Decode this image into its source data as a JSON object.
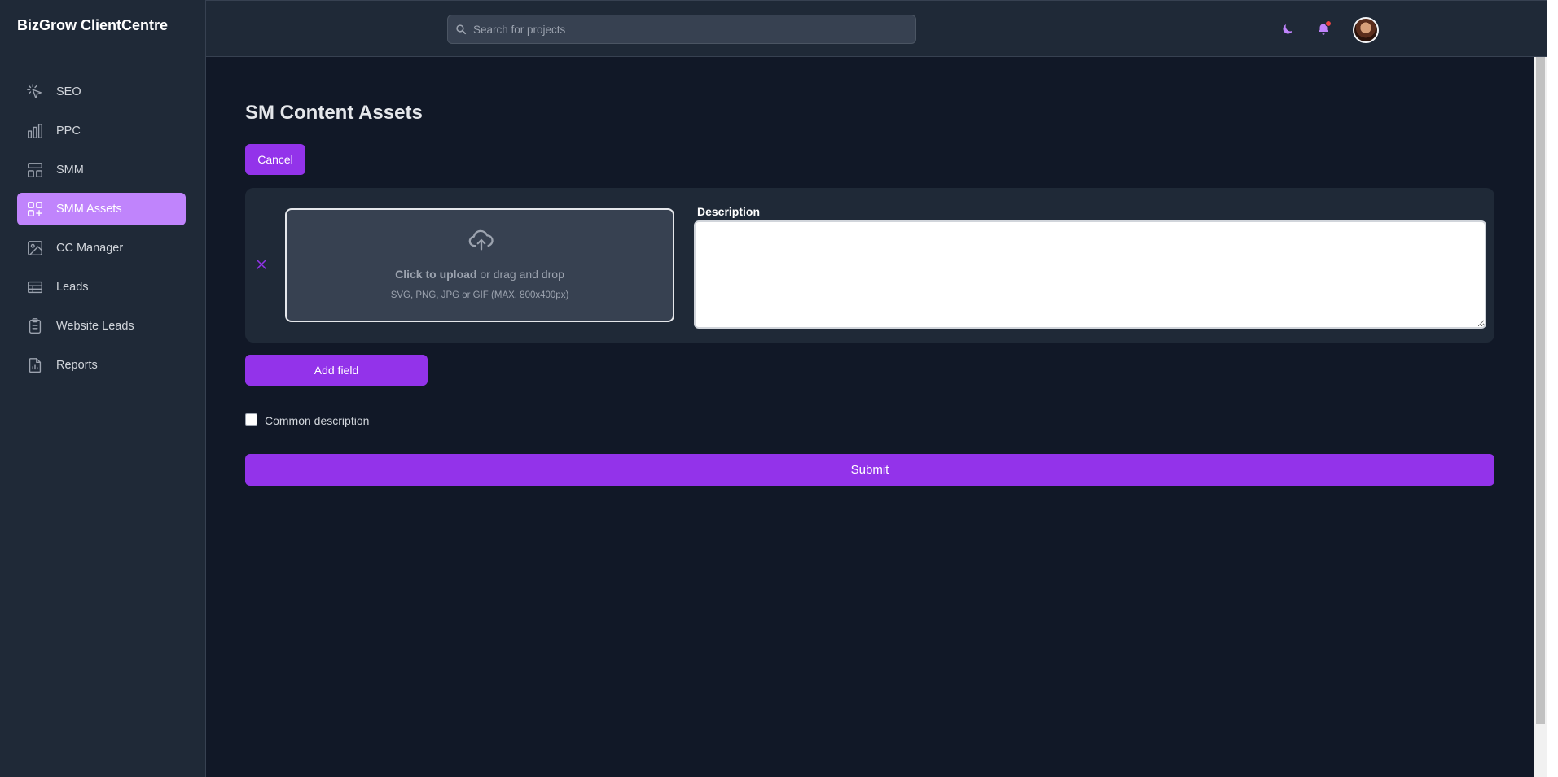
{
  "app": {
    "brand": "BizGrow ClientCentre"
  },
  "sidebar": {
    "items": [
      {
        "label": "SEO",
        "icon": "cursor-click-icon",
        "active": false
      },
      {
        "label": "PPC",
        "icon": "bar-chart-icon",
        "active": false
      },
      {
        "label": "SMM",
        "icon": "layout-icon",
        "active": false
      },
      {
        "label": "SMM Assets",
        "icon": "grid-plus-icon",
        "active": true
      },
      {
        "label": "CC Manager",
        "icon": "image-icon",
        "active": false
      },
      {
        "label": "Leads",
        "icon": "table-icon",
        "active": false
      },
      {
        "label": "Website Leads",
        "icon": "clipboard-icon",
        "active": false
      },
      {
        "label": "Reports",
        "icon": "document-chart-icon",
        "active": false
      }
    ]
  },
  "header": {
    "search": {
      "placeholder": "Search for projects",
      "value": ""
    },
    "icons": [
      "moon-icon",
      "bell-icon",
      "avatar"
    ]
  },
  "page": {
    "title": "SM Content Assets",
    "cancel_label": "Cancel",
    "upload": {
      "primary_bold": "Click to upload",
      "primary_rest": " or drag and drop",
      "hint": "SVG, PNG, JPG or GIF (MAX. 800x400px)"
    },
    "description_label": "Description",
    "description_value": "",
    "add_field_label": "Add field",
    "common_description_label": "Common description",
    "common_description_checked": false,
    "submit_label": "Submit"
  },
  "colors": {
    "accent": "#9333ea",
    "active_nav": "#c084fc",
    "background": "#111827",
    "panel": "#1f2937",
    "notification_dot": "#ef4444"
  }
}
